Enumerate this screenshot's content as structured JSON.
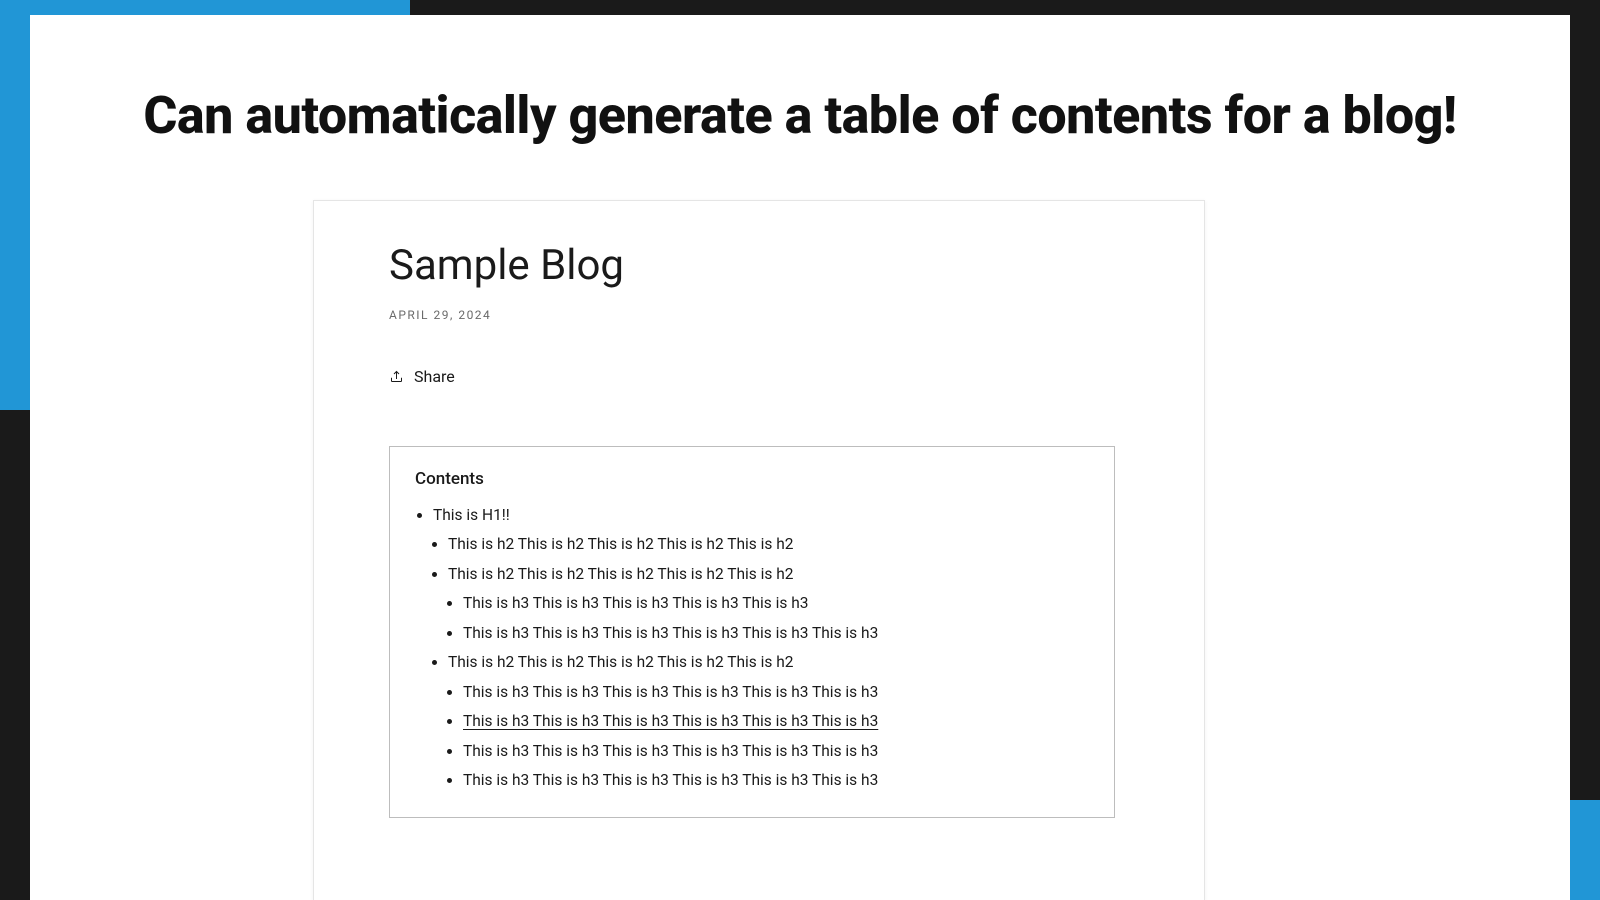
{
  "headline": "Can automatically generate a table of contents for a blog!",
  "blog": {
    "title": "Sample Blog",
    "date": "APRIL 29, 2024",
    "share_label": "Share"
  },
  "toc": {
    "title": "Contents",
    "items": [
      {
        "label": "This is H1!!",
        "children": [
          {
            "label": "This is h2 This is h2 This is h2 This is h2 This is h2",
            "children": []
          },
          {
            "label": "This is h2 This is h2 This is h2 This is h2 This is h2",
            "children": [
              {
                "label": "This is h3 This is h3 This is h3 This is h3 This is h3"
              },
              {
                "label": "This is h3 This is h3 This is h3 This is h3 This is h3 This is h3"
              }
            ]
          },
          {
            "label": "This is h2 This is h2 This is h2 This is h2 This is h2",
            "children": [
              {
                "label": "This is h3 This is h3 This is h3 This is h3 This is h3 This is h3"
              },
              {
                "label": "This is h3 This is h3 This is h3 This is h3 This is h3 This is h3",
                "underline": true
              },
              {
                "label": "This is h3 This is h3 This is h3 This is h3 This is h3 This is h3"
              },
              {
                "label": "This is h3 This is h3 This is h3 This is h3 This is h3 This is h3"
              }
            ]
          }
        ]
      }
    ]
  }
}
